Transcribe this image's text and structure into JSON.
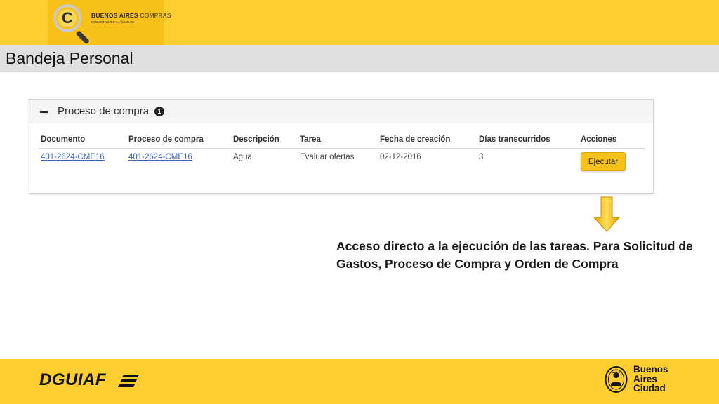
{
  "logo": {
    "brand_bold": "BUENOS AIRES",
    "brand_light": " COMPRAS",
    "subtitle": "GOBIERNO DE LA CIUDAD",
    "letter": "C"
  },
  "header": {
    "title": "Bandeja Personal"
  },
  "panel": {
    "title": "Proceso de compra",
    "count": "1",
    "columns": [
      "Documento",
      "Proceso de compra",
      "Descripción",
      "Tarea",
      "Fecha de creación",
      "Días transcurridos",
      "Acciones"
    ],
    "rows": [
      {
        "documento": "401-2624-CME16",
        "proceso": "401-2624-CME16",
        "descripcion": "Agua",
        "tarea": "Evaluar ofertas",
        "fecha": "02-12-2016",
        "dias": "3",
        "action_label": "Ejecutar"
      }
    ]
  },
  "callout": {
    "text": "Acceso directo a la ejecución de las tareas. Para Solicitud de Gastos, Proceso de Compra y Orden de Compra"
  },
  "footer": {
    "left_logo": "DGUIAF",
    "right_logo_lines": [
      "Buenos",
      "Aires",
      "Ciudad"
    ]
  },
  "colors": {
    "brand_yellow": "#fecd2f",
    "button_yellow": "#f8c11a",
    "link_blue": "#3a63b8",
    "title_bar_gray": "#e0e0e0"
  }
}
